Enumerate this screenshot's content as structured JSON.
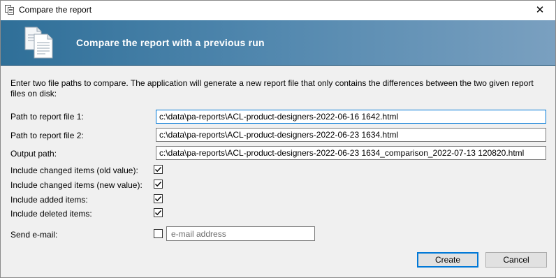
{
  "window": {
    "title": "Compare the report",
    "close_glyph": "✕"
  },
  "banner": {
    "title": "Compare the report with a previous run",
    "icon": "document-stack-icon"
  },
  "intro_text": "Enter two file paths to compare. The application will generate a new report file that only contains the differences between the two given report files on disk:",
  "fields": {
    "file1": {
      "label": "Path to report file 1:",
      "value": "c:\\data\\pa-reports\\ACL-product-designers-2022-06-16 1642.html"
    },
    "file2": {
      "label": "Path to report file 2:",
      "value": "c:\\data\\pa-reports\\ACL-product-designers-2022-06-23 1634.html"
    },
    "output": {
      "label": "Output path:",
      "value": "c:\\data\\pa-reports\\ACL-product-designers-2022-06-23 1634_comparison_2022-07-13 120820.html"
    }
  },
  "options": {
    "changed_old": {
      "label": "Include changed items (old value):",
      "checked": true
    },
    "changed_new": {
      "label": "Include changed items (new value):",
      "checked": true
    },
    "added": {
      "label": "Include added items:",
      "checked": true
    },
    "deleted": {
      "label": "Include deleted items:",
      "checked": true
    }
  },
  "email": {
    "label": "Send e-mail:",
    "checked": false,
    "placeholder": "e-mail address",
    "value": ""
  },
  "buttons": {
    "create": "Create",
    "cancel": "Cancel"
  },
  "colors": {
    "accent": "#0078d7",
    "banner_start": "#2f6f98",
    "banner_end": "#7aa0c0"
  }
}
